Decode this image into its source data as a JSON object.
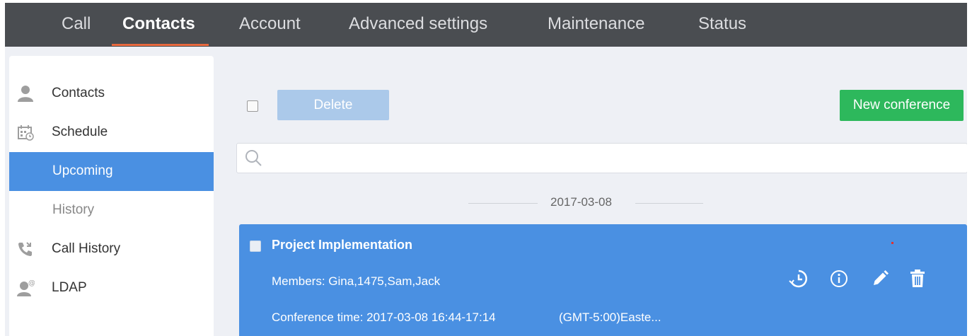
{
  "nav": {
    "tabs": [
      {
        "label": "Call"
      },
      {
        "label": "Contacts"
      },
      {
        "label": "Account"
      },
      {
        "label": "Advanced settings"
      },
      {
        "label": "Maintenance"
      },
      {
        "label": "Status"
      }
    ],
    "active_tab": "Contacts",
    "accent_color": "#e8693f"
  },
  "sidebar": {
    "items": [
      {
        "label": "Contacts",
        "icon": "person-icon"
      },
      {
        "label": "Schedule",
        "icon": "calendar-icon"
      },
      {
        "label": "Upcoming",
        "icon": "",
        "selected": true
      },
      {
        "label": "History",
        "icon": ""
      },
      {
        "label": "Call History",
        "icon": "phone-history-icon"
      },
      {
        "label": "LDAP",
        "icon": "ldap-person-icon"
      }
    ],
    "selected_color": "#4a90e2"
  },
  "toolbar": {
    "delete_label": "Delete",
    "new_conference_label": "New conference",
    "new_conference_color": "#2db85c"
  },
  "search": {
    "placeholder": "",
    "value": ""
  },
  "list": {
    "date_header": "2017-03-08",
    "conferences": [
      {
        "title": "Project Implementation",
        "members": "Members:  Gina,1475,Sam,Jack",
        "conference_time": "Conference time: 2017-03-08 16:44-17:14",
        "timezone": "(GMT-5:00)Easte...",
        "actions": [
          "history-clock-icon",
          "info-icon",
          "edit-pencil-icon",
          "delete-trash-icon"
        ]
      }
    ]
  }
}
